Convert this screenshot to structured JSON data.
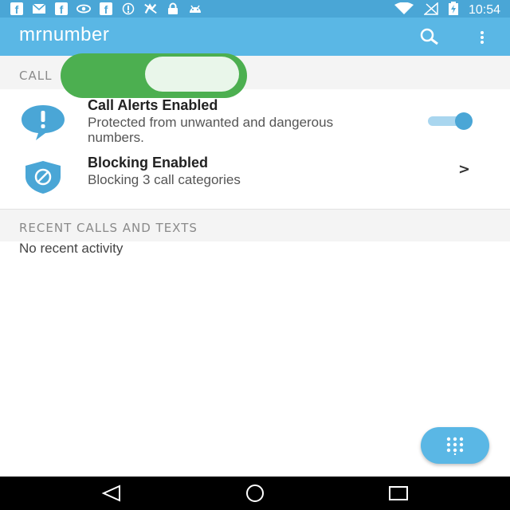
{
  "status_bar": {
    "time": "10:54",
    "left_icons": [
      "facebook-icon",
      "message-icon",
      "facebook-icon",
      "nvidia-icon",
      "facebook-icon",
      "info-icon",
      "no-signal-icon",
      "lock-icon",
      "android-icon"
    ],
    "right_icons": [
      "wifi-icon",
      "signal-icon",
      "battery-charging-icon"
    ]
  },
  "app_bar": {
    "title": "mrnumber",
    "search_icon": "search-icon",
    "more_icon": "more-vert-icon",
    "color": "#5ab7e5"
  },
  "sections": {
    "calls_header": "CALL",
    "recent_header": "RECENT CALLS AND TEXTS"
  },
  "rows": [
    {
      "icon": "alert-bubble-icon",
      "title": "Call Alerts Enabled",
      "subtitle": "Protected from unwanted and dangerous numbers.",
      "toggle_on": true
    },
    {
      "icon": "shield-block-icon",
      "title": "Blocking Enabled",
      "subtitle": "Blocking 3 call categories",
      "chevron": ">"
    }
  ],
  "recent": {
    "empty_text": "No recent activity"
  },
  "fab": {
    "icon": "dialpad-icon"
  },
  "nav": {
    "back": "back-icon",
    "home": "home-icon",
    "recents": "recents-icon"
  },
  "colors": {
    "accent": "#5ab7e5",
    "overlay_toggle": "#4caf50",
    "switch_thumb": "#4aa6d6"
  }
}
